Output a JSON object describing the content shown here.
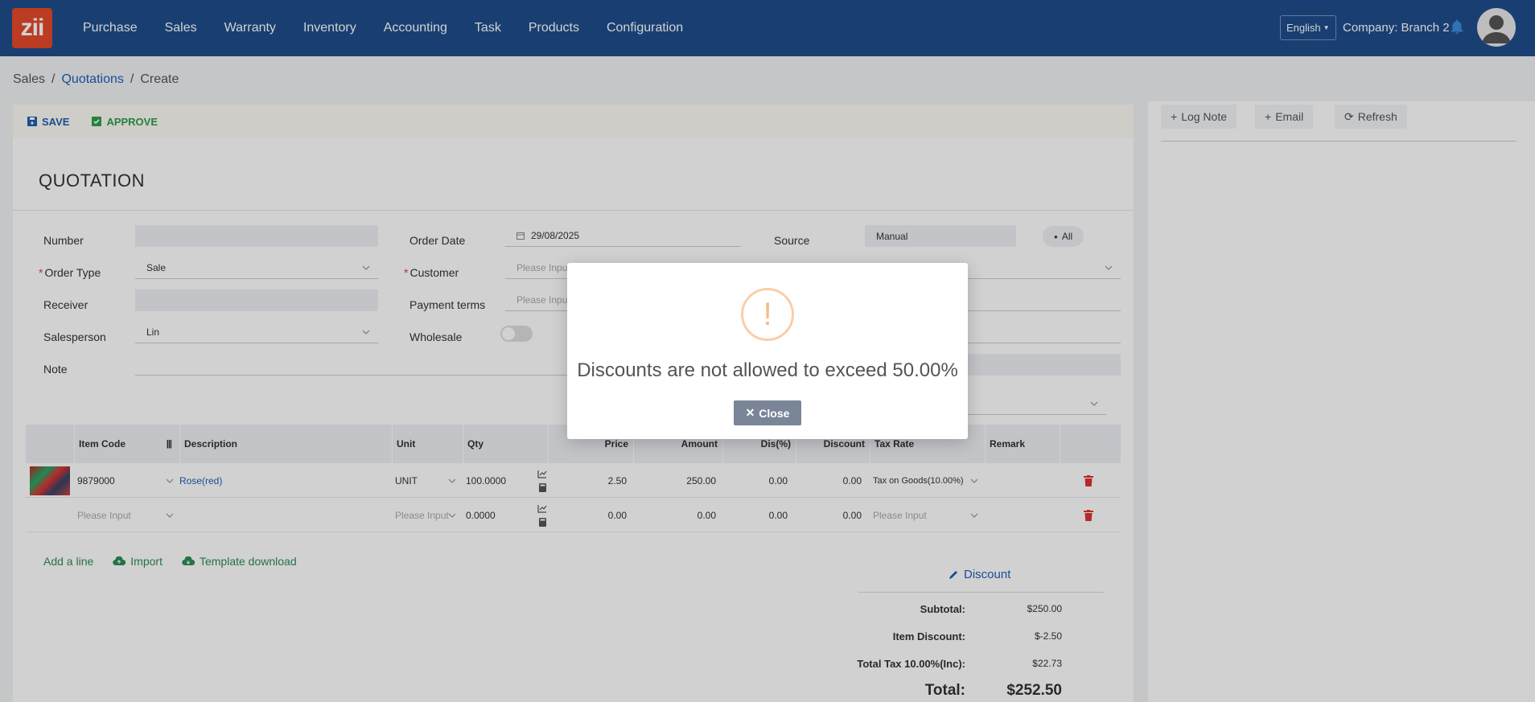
{
  "nav": {
    "logo": "zii",
    "menu": [
      "Purchase",
      "Sales",
      "Warranty",
      "Inventory",
      "Accounting",
      "Task",
      "Products",
      "Configuration"
    ],
    "language": "English",
    "company": "Company: Branch 2"
  },
  "breadcrumb": {
    "root": "Sales",
    "section": "Quotations",
    "current": "Create",
    "sep": "/"
  },
  "toolbar": {
    "save": "SAVE",
    "approve": "APPROVE"
  },
  "form": {
    "title": "QUOTATION",
    "number_label": "Number",
    "number_value": "",
    "order_date_label": "Order Date",
    "order_date_value": "29/08/2025",
    "source_label": "Source",
    "source_value": "Manual",
    "all_label": "All",
    "order_type_label": "Order Type",
    "order_type_value": "Sale",
    "customer_label": "Customer",
    "customer_placeholder": "Please Input",
    "receiver_label": "Receiver",
    "payment_terms_label": "Payment terms",
    "payment_terms_placeholder": "Please Input",
    "salesperson_label": "Salesperson",
    "salesperson_value": "Lin",
    "wholesale_label": "Wholesale",
    "note_label": "Note"
  },
  "table": {
    "headers": {
      "item_code": "Item Code",
      "description": "Description",
      "unit": "Unit",
      "qty": "Qty",
      "price": "Price",
      "amount": "Amount",
      "dis_pct": "Dis(%)",
      "discount": "Discount",
      "tax_rate": "Tax Rate",
      "remark": "Remark"
    },
    "rows": [
      {
        "item_code": "9879000",
        "description": "Rose(red)",
        "unit": "UNIT",
        "qty": "100.0000",
        "price": "2.50",
        "amount": "250.00",
        "dis_pct": "0.00",
        "discount": "0.00",
        "tax_rate": "Tax on Goods(10.00%)"
      },
      {
        "item_code": "Please Input",
        "description": "",
        "unit": "Please Input",
        "qty": "0.0000",
        "price": "0.00",
        "amount": "0.00",
        "dis_pct": "0.00",
        "discount": "0.00",
        "tax_rate": "Please Input"
      }
    ]
  },
  "actions": {
    "add_line": "Add a line",
    "import": "Import",
    "template": "Template download"
  },
  "summary": {
    "discount_link": "Discount",
    "subtotal_label": "Subtotal:",
    "subtotal": "$250.00",
    "item_discount_label": "Item Discount:",
    "item_discount": "$-2.50",
    "tax_label": "Total Tax 10.00%(Inc):",
    "tax": "$22.73",
    "total_label": "Total:",
    "total": "$252.50"
  },
  "side": {
    "log_note": "Log Note",
    "email": "Email",
    "refresh": "Refresh"
  },
  "modal": {
    "icon": "!",
    "message": "Discounts are not allowed to exceed 50.00%",
    "close": "Close"
  },
  "colors": {
    "nav": "#1f4e8c",
    "accent": "#1f5fb5",
    "approve": "#2e9e4e",
    "danger": "#e33",
    "warning": "#f8bb86"
  }
}
